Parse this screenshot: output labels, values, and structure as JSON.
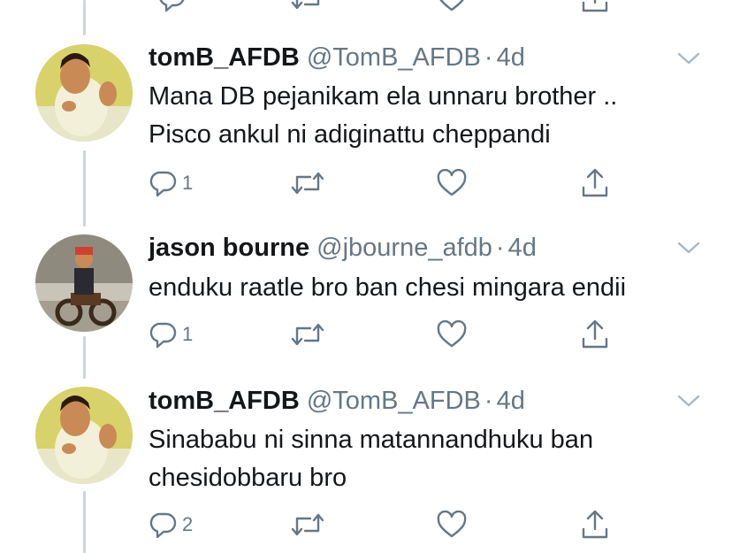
{
  "colors": {
    "thread_line": "#ccd6dd",
    "secondary_text": "#657786",
    "primary_text": "#14171a"
  },
  "tweets": [
    {
      "name": "tomB_AFDB",
      "handle": "@TomB_AFDB",
      "separator": "·",
      "time": "4d",
      "lines": [
        "Mana DB pejanikam ela unnaru brother ..",
        "Pisco ankul ni adiginattu cheppandi"
      ],
      "reply_count": "1",
      "avatar": "cartoon-man-avatar"
    },
    {
      "name": "jason bourne",
      "handle": "@jbourne_afdb",
      "separator": "·",
      "time": "4d",
      "lines": [
        "enduku raatle bro ban chesi mingara endii"
      ],
      "reply_count": "1",
      "avatar": "motorbike-rider-avatar"
    },
    {
      "name": "tomB_AFDB",
      "handle": "@TomB_AFDB",
      "separator": "·",
      "time": "4d",
      "lines": [
        "Sinababu ni sinna matannandhuku ban",
        "chesidobbaru bro"
      ],
      "reply_count": "2",
      "avatar": "cartoon-man-avatar"
    }
  ],
  "icons": {
    "reply": "reply-icon",
    "retweet": "retweet-icon",
    "like": "like-icon",
    "share": "share-icon",
    "caret": "chevron-down-icon"
  }
}
